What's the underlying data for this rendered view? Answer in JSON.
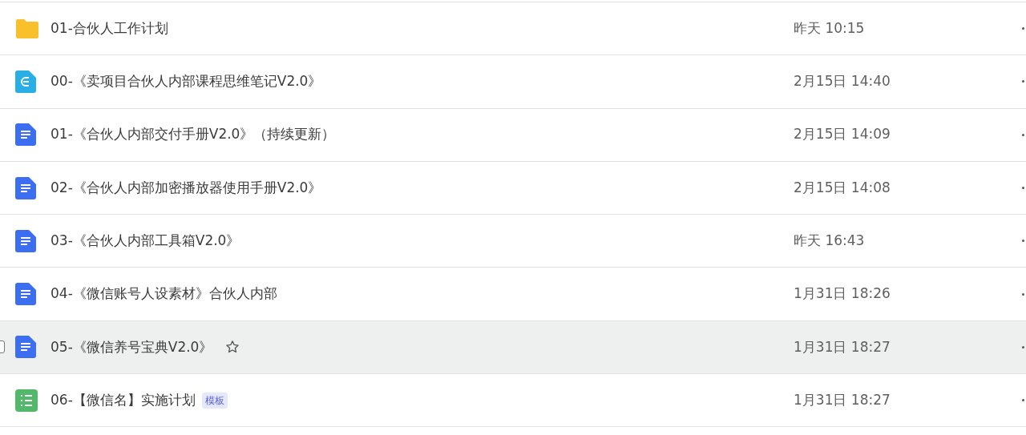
{
  "files": [
    {
      "kind": "folder",
      "name": "01-合伙人工作计划",
      "modified": "昨天 10:15",
      "hovered": false
    },
    {
      "kind": "mindmap",
      "name": "00-《卖项目合伙人内部课程思维笔记V2.0》",
      "modified": "2月15日 14:40",
      "hovered": false
    },
    {
      "kind": "doc",
      "name": "01-《合伙人内部交付手册V2.0》（持续更新）",
      "modified": "2月15日 14:09",
      "hovered": false
    },
    {
      "kind": "doc",
      "name": "02-《合伙人内部加密播放器使用手册V2.0》",
      "modified": "2月15日 14:08",
      "hovered": false
    },
    {
      "kind": "doc",
      "name": "03-《合伙人内部工具箱V2.0》",
      "modified": "昨天 16:43",
      "hovered": false
    },
    {
      "kind": "doc",
      "name": "04-《微信账号人设素材》合伙人内部",
      "modified": "1月31日 18:26",
      "hovered": false
    },
    {
      "kind": "doc",
      "name": "05-《微信养号宝典V2.0》",
      "modified": "1月31日 18:27",
      "hovered": true
    },
    {
      "kind": "sheet",
      "name": "06-【微信名】实施计划",
      "tag": "模板",
      "modified": "1月31日 18:27",
      "hovered": false
    }
  ]
}
